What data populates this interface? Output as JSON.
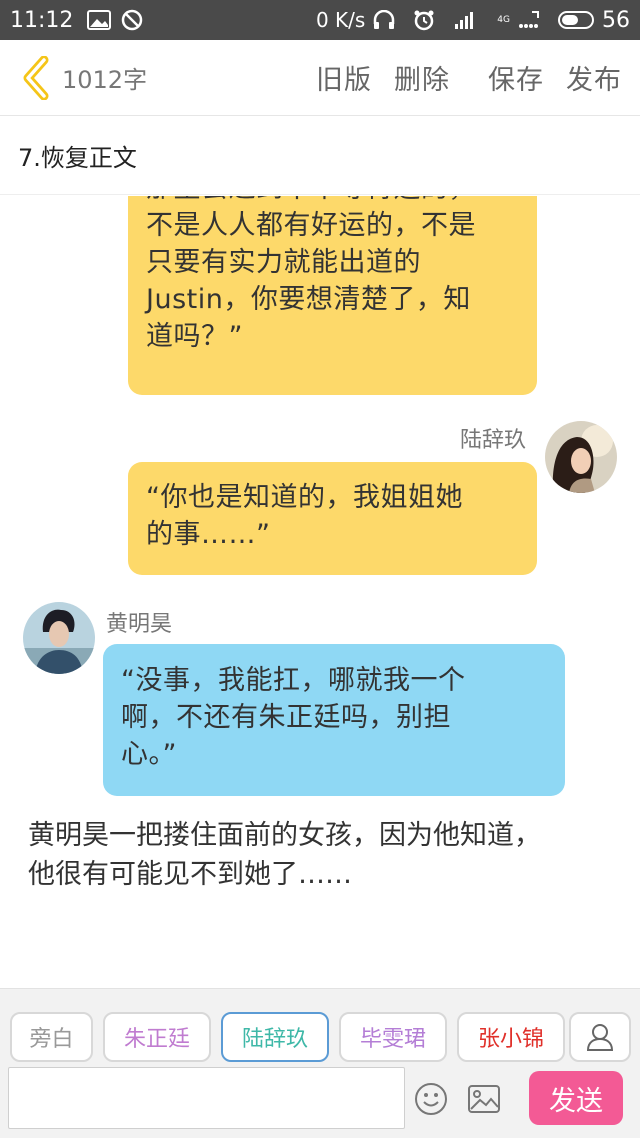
{
  "status_bar": {
    "time": "11:12",
    "net_speed": "0 K/s",
    "carrier_top": "4G",
    "battery": "56",
    "battery_level": 0.56
  },
  "header": {
    "word_count": "1012字",
    "actions": [
      "旧版",
      "删除",
      "保存",
      "发布"
    ]
  },
  "chapter": {
    "title": "7.恢复正文"
  },
  "messages": [
    {
      "side": "right",
      "color": "#fdd96a",
      "lines": [
        "那里会遭到不平等待遇的，",
        "不是人人都有好运的，不是",
        "只要有实力就能出道的",
        "Justin，你要想清楚了，知",
        "道吗？”"
      ]
    },
    {
      "side": "right",
      "speaker": "陆辞玖",
      "color": "#fdd96a",
      "lines": [
        "“你也是知道的，我姐姐她",
        "的事……”"
      ]
    },
    {
      "side": "left",
      "speaker": "黄明昊",
      "color": "#8fd8f4",
      "lines": [
        "“没事，我能扛，哪就我一个",
        "啊，不还有朱正廷吗，别担",
        "心。”"
      ]
    }
  ],
  "narration": {
    "lines": [
      "黄明昊一把搂住面前的女孩，因为他知道，",
      "他很有可能见不到她了……"
    ]
  },
  "characters": [
    {
      "name": "旁白",
      "color": "#999999"
    },
    {
      "name": "朱正廷",
      "color": "#c07cd0"
    },
    {
      "name": "陆辞玖",
      "color": "#3fb8a8"
    },
    {
      "name": "毕雯珺",
      "color": "#b47ed6"
    },
    {
      "name": "张小锦",
      "color": "#e0302a"
    }
  ],
  "composer": {
    "placeholder": "",
    "send_label": "发送",
    "send_color": "#f35a95"
  }
}
